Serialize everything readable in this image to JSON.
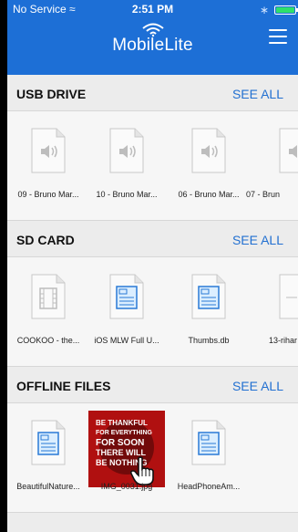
{
  "status_bar": {
    "carrier": "No Service",
    "time": "2:51 PM"
  },
  "header": {
    "app_name": "MobileLite"
  },
  "sections": [
    {
      "title": "USB DRIVE",
      "see_all": "SEE ALL",
      "items": [
        {
          "caption": "09 - Bruno Mar...",
          "icon": "audio-file-icon"
        },
        {
          "caption": "10 - Bruno Mar...",
          "icon": "audio-file-icon"
        },
        {
          "caption": "06 - Bruno Mar...",
          "icon": "audio-file-icon"
        },
        {
          "caption": "07 - Brun",
          "icon": "audio-file-icon"
        }
      ]
    },
    {
      "title": "SD CARD",
      "see_all": "SEE ALL",
      "items": [
        {
          "caption": "COOKOO - the...",
          "icon": "video-file-icon"
        },
        {
          "caption": "iOS MLW Full U...",
          "icon": "document-file-icon"
        },
        {
          "caption": "Thumbs.db",
          "icon": "document-file-icon"
        },
        {
          "caption": "13-rihar",
          "icon": "document-file-icon"
        }
      ]
    },
    {
      "title": "OFFLINE FILES",
      "see_all": "SEE ALL",
      "items": [
        {
          "caption": "BeautifulNature...",
          "icon": "document-file-icon"
        },
        {
          "caption": "IMG_0031.jpg",
          "icon": "image-thumbnail",
          "image_text": [
            "BE THANKFUL",
            "FOR EVERYTHING",
            "FOR SOON",
            "THERE WILL",
            "BE NOTHING"
          ]
        },
        {
          "caption": "HeadPhoneAm...",
          "icon": "document-file-icon"
        }
      ]
    }
  ]
}
